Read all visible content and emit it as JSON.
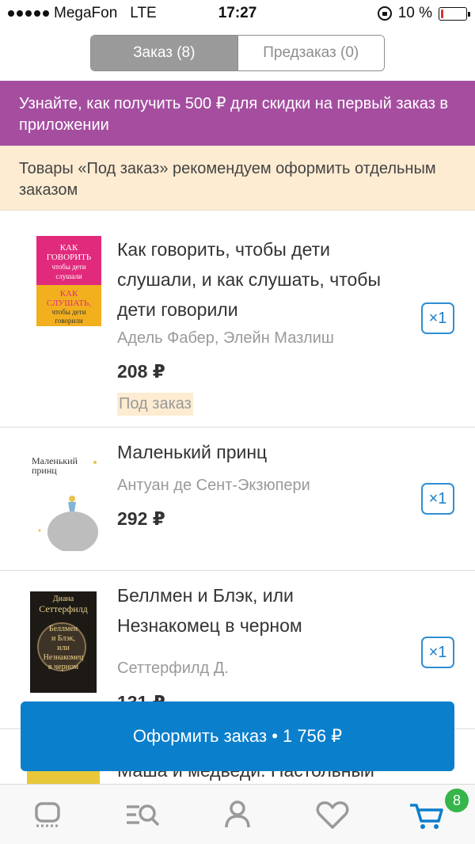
{
  "status_bar": {
    "carrier": "MegaFon",
    "network": "LTE",
    "time": "17:27",
    "battery": "10 %",
    "battery_level": 0.1
  },
  "segment": {
    "tabs": [
      {
        "label": "Заказ (8)",
        "active": true
      },
      {
        "label": "Предзаказ (0)",
        "active": false
      }
    ]
  },
  "promo_banner": "Узнайте, как получить 500 ₽ для скидки на первый заказ в приложении",
  "info_banner": "Товары «Под заказ» рекомендуем оформить отдельным заказом",
  "items": [
    {
      "title_lines": [
        "Как говорить, чтобы дети",
        "слушали, и как слушать, чтобы",
        "дети говорили"
      ],
      "author": "Адель Фабер, Элейн Мазлиш",
      "price": "208 ₽",
      "tag": "Под заказ",
      "qty": "×1",
      "cover": {
        "top_color": "#e22a7c",
        "bottom_color": "#f2b01e",
        "lines": [
          "КАК",
          "ГОВОРИТЬ",
          "чтобы дети",
          "слушали",
          "КАК",
          "СЛУШАТЬ,",
          "чтобы дети",
          "говорили"
        ]
      }
    },
    {
      "title_lines": [
        "Маленький принц"
      ],
      "author": "Антуан де Сент-Экзюпери",
      "price": "292 ₽",
      "qty": "×1",
      "cover": {
        "lines": [
          "Маленький",
          "принц"
        ]
      }
    },
    {
      "title_lines": [
        "Беллмен и Блэк, или",
        "Незнакомец в черном"
      ],
      "author": "Сеттерфилд Д.",
      "price": "131 ₽",
      "qty": "×1",
      "cover": {
        "lines": [
          "Диана",
          "Сеттерфилд",
          "Беллмен",
          "и Блэк,",
          "или",
          "Незнакомец",
          "в черном"
        ]
      }
    }
  ],
  "checkout_label": "Оформить заказ • 1 756 ₽",
  "peek_item_title": "Маша и медведи. Настольный",
  "tabbar": {
    "cart_badge": "8",
    "icons": [
      "home-icon",
      "catalog-search-icon",
      "profile-icon",
      "heart-icon",
      "cart-icon"
    ]
  },
  "colors": {
    "promo_bg": "#a54ea0",
    "info_bg": "#fdecd2",
    "accent": "#0a7fcc",
    "badge": "#35b54a"
  }
}
